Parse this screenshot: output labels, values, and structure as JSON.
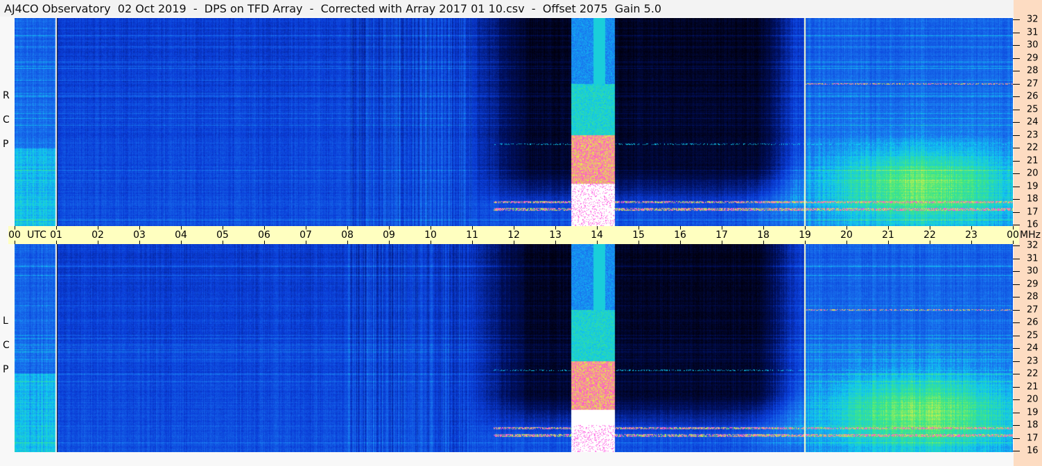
{
  "title": "AJ4CO Observatory  02 Oct 2019  -  DPS on TFD Array  -  Corrected with Array 2017 01 10.csv  -  Offset 2075  Gain 5.0",
  "chart_data": {
    "type": "heatmap",
    "title": "AJ4CO Observatory  02 Oct 2019  -  DPS on TFD Array  -  Corrected with Array 2017 01 10.csv  -  Offset 2075  Gain 5.0",
    "xlabel": "UTC",
    "ylabel": "MHz",
    "x_range": [
      0,
      24
    ],
    "y_range": [
      16,
      32
    ],
    "x_ticks": [
      "00",
      "01",
      "02",
      "03",
      "04",
      "05",
      "06",
      "07",
      "08",
      "09",
      "10",
      "11",
      "12",
      "13",
      "14",
      "15",
      "16",
      "17",
      "18",
      "19",
      "20",
      "21",
      "22",
      "23",
      "00"
    ],
    "y_ticks": [
      "32",
      "31",
      "30",
      "29",
      "28",
      "27",
      "26",
      "25",
      "24",
      "23",
      "22",
      "21",
      "20",
      "19",
      "18",
      "17",
      "16"
    ],
    "panels": [
      {
        "name": "RCP",
        "label": [
          "R",
          "C",
          "P"
        ]
      },
      {
        "name": "LCP",
        "label": [
          "L",
          "C",
          "P"
        ]
      }
    ],
    "features": {
      "burst_utc": [
        13.4,
        14.4
      ],
      "burst_saturated_below_mhz": 19,
      "dark_period_utc": [
        11.5,
        18.8
      ],
      "markers_utc": [
        1,
        19
      ]
    },
    "utc_label": "UTC",
    "mhz_label": "MHz"
  }
}
